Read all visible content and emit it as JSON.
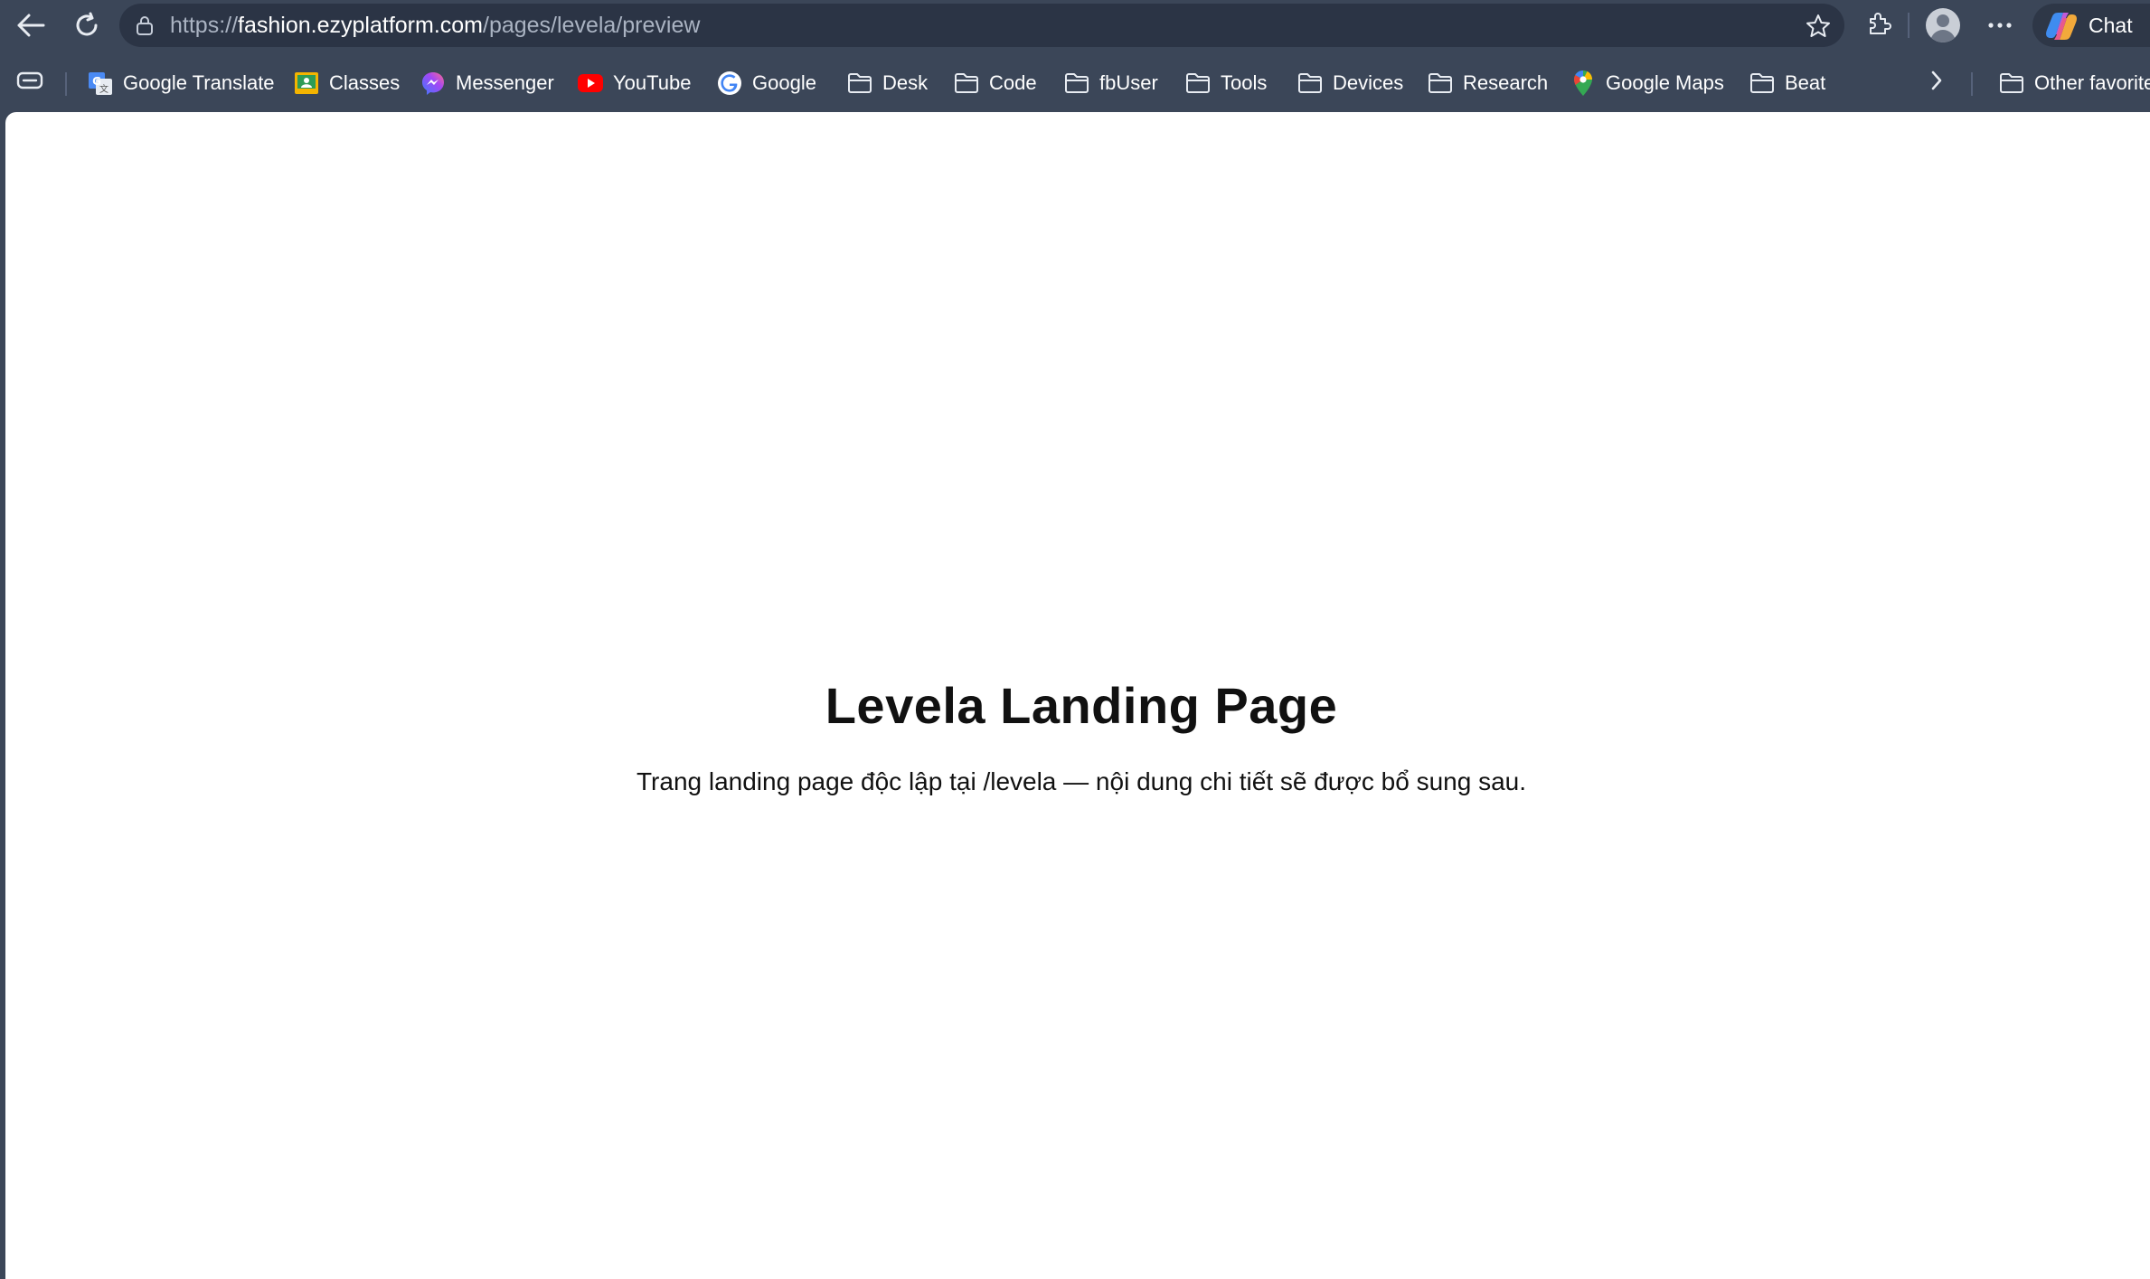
{
  "browser": {
    "url_prefix": "https://",
    "url_host": "fashion.ezyplatform.com",
    "url_path": "/pages/levela/preview",
    "chat_label": "Chat"
  },
  "bookmarks": [
    {
      "label": "Google Translate",
      "icon": "google-translate-icon"
    },
    {
      "label": "Classes",
      "icon": "classes-icon"
    },
    {
      "label": "Messenger",
      "icon": "messenger-icon"
    },
    {
      "label": "YouTube",
      "icon": "youtube-icon"
    },
    {
      "label": "Google",
      "icon": "google-icon"
    },
    {
      "label": "Desk",
      "icon": "folder-icon"
    },
    {
      "label": "Code",
      "icon": "folder-icon"
    },
    {
      "label": "fbUser",
      "icon": "folder-icon"
    },
    {
      "label": "Tools",
      "icon": "folder-icon"
    },
    {
      "label": "Devices",
      "icon": "folder-icon"
    },
    {
      "label": "Research",
      "icon": "folder-icon"
    },
    {
      "label": "Google Maps",
      "icon": "google-maps-icon"
    },
    {
      "label": "Beat",
      "icon": "folder-icon"
    }
  ],
  "other_favorites": "Other favorite",
  "page": {
    "title": "Levela Landing Page",
    "subtitle": "Trang landing page độc lập tại /levela — nội dung chi tiết sẽ được bổ sung sau."
  }
}
